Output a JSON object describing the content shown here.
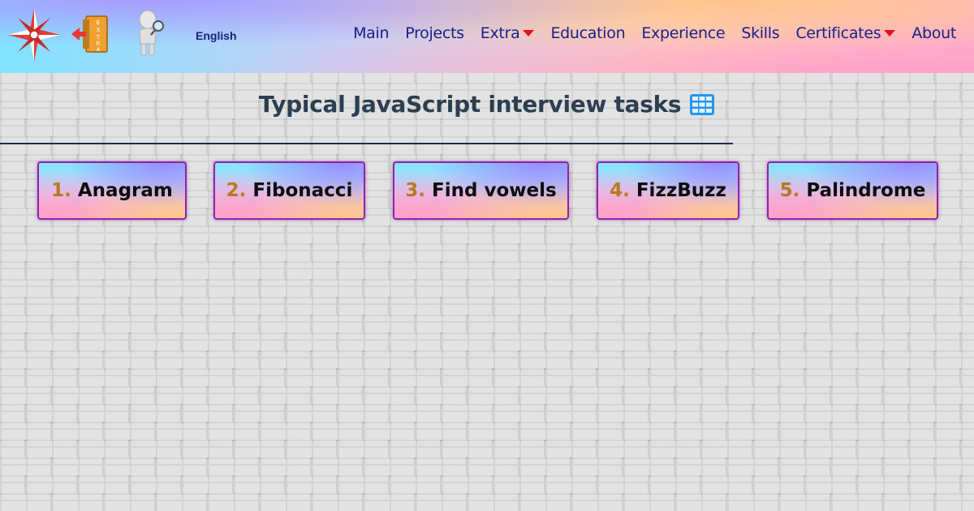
{
  "header": {
    "language": "English",
    "extra_badge": "EXTRA",
    "nav": [
      {
        "label": "Main",
        "dropdown": false
      },
      {
        "label": "Projects",
        "dropdown": false
      },
      {
        "label": "Extra",
        "dropdown": true
      },
      {
        "label": "Education",
        "dropdown": false
      },
      {
        "label": "Experience",
        "dropdown": false
      },
      {
        "label": "Skills",
        "dropdown": false
      },
      {
        "label": "Certificates",
        "dropdown": true
      },
      {
        "label": "About",
        "dropdown": false
      }
    ]
  },
  "main": {
    "title": "Typical JavaScript interview tasks",
    "title_icon": "grid-icon",
    "tasks": [
      {
        "number": "1.",
        "label": "Anagram"
      },
      {
        "number": "2.",
        "label": "Fibonacci"
      },
      {
        "number": "3.",
        "label": "Find vowels"
      },
      {
        "number": "4.",
        "label": "FizzBuzz"
      },
      {
        "number": "5.",
        "label": "Palindrome"
      }
    ]
  },
  "colors": {
    "nav_text": "#17208a",
    "caret": "#e8101a",
    "task_number": "#b7791f",
    "task_border": "#8e24aa",
    "title_text": "#2c3e50"
  }
}
